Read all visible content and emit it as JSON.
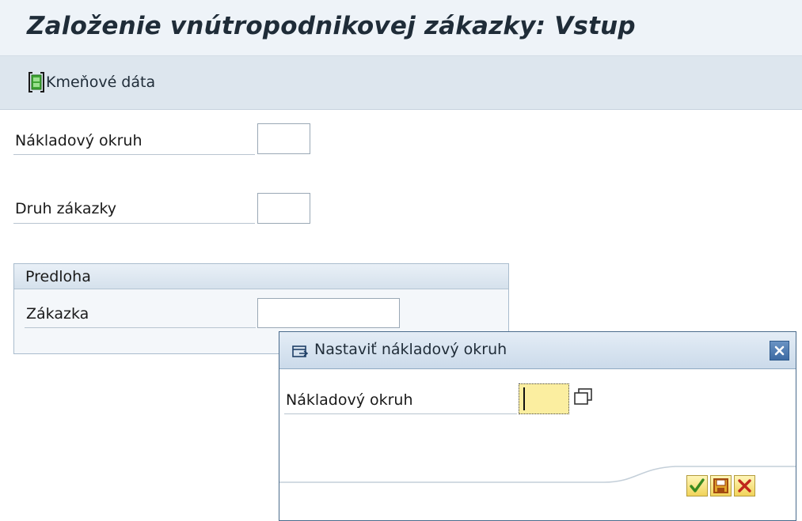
{
  "window": {
    "title": "Založenie vnútropodnikovej zákazky: Vstup"
  },
  "toolbar": {
    "master_data_label": "Kmeňové dáta"
  },
  "fields": {
    "cost_area_label": "Nákladový okruh",
    "cost_area_value": "",
    "order_type_label": "Druh zákazky",
    "order_type_value": ""
  },
  "template_group": {
    "title": "Predloha",
    "order_label": "Zákazka",
    "order_value": ""
  },
  "dialog": {
    "title": "Nastaviť nákladový okruh",
    "field_label": "Nákladový okruh",
    "field_value": ""
  },
  "colors": {
    "accent": "#3c6aa3",
    "required_field": "#fbeea0",
    "confirm": "#3a8a20",
    "cancel": "#c0281c"
  },
  "icons": {
    "toolbar": "master-data-icon",
    "dialog": "window-icon",
    "value_help": "value-help-icon",
    "close": "close-icon",
    "confirm": "checkmark-icon",
    "save": "save-icon",
    "cancel": "cancel-icon"
  }
}
